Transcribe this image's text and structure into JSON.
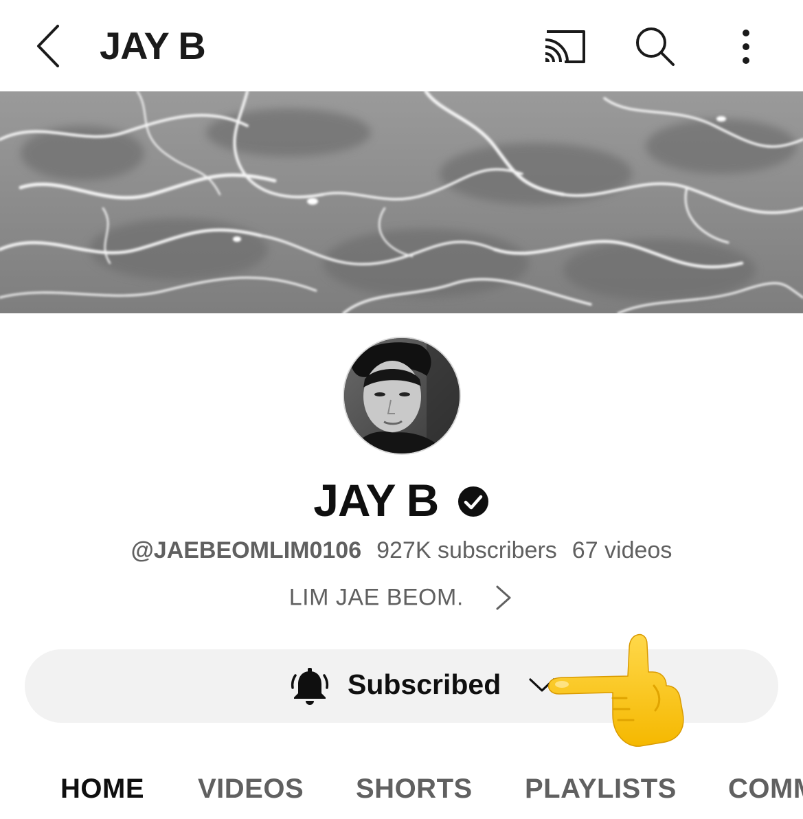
{
  "header": {
    "title": "JAY B",
    "back_icon": "chevron-left-icon",
    "cast_icon": "cast-icon",
    "search_icon": "search-icon",
    "more_icon": "more-vert-icon"
  },
  "channel": {
    "name": "JAY B",
    "verified": true,
    "handle": "@JAEBEOMLIM0106",
    "subscribers": "927K subscribers",
    "videos": "67 videos",
    "description": "LIM JAE BEOM."
  },
  "subscribe": {
    "label": "Subscribed",
    "bell_icon": "bell-icon",
    "dropdown_icon": "chevron-down-icon"
  },
  "tabs": [
    {
      "label": "HOME",
      "active": true
    },
    {
      "label": "VIDEOS",
      "active": false
    },
    {
      "label": "SHORTS",
      "active": false
    },
    {
      "label": "PLAYLISTS",
      "active": false
    },
    {
      "label": "COMMUNITY",
      "active": false
    }
  ],
  "colors": {
    "text_primary": "#0f0f0f",
    "text_secondary": "#606060",
    "pill_bg": "#f2f2f2"
  }
}
